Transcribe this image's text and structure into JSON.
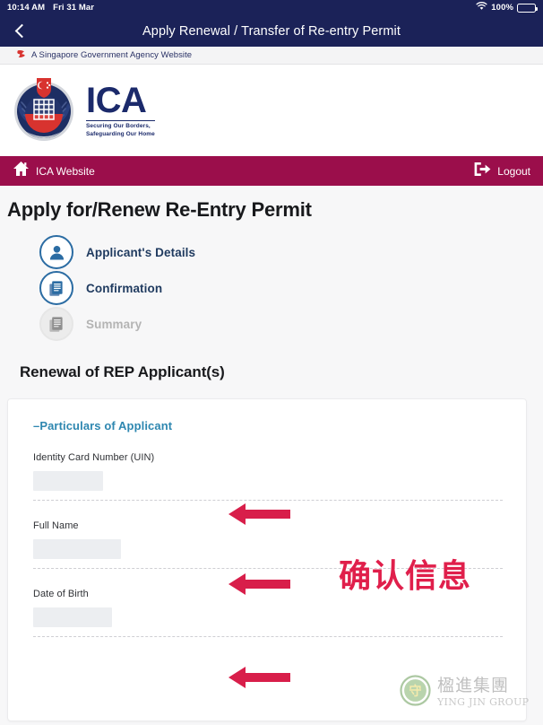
{
  "status_bar": {
    "time": "10:14 AM",
    "date": "Fri 31 Mar",
    "battery_percent": "100%",
    "wifi_icon": "wifi-icon",
    "battery_icon": "battery-full-icon"
  },
  "app_bar": {
    "back_icon": "back-chevron-icon",
    "title": "Apply Renewal / Transfer of Re-entry Permit"
  },
  "gov_banner": {
    "icon": "singapore-flag-icon",
    "text": "A Singapore Government Agency Website"
  },
  "branding": {
    "crest_icon": "ica-crest-icon",
    "acronym": "ICA",
    "tagline_line1": "Securing Our Borders,",
    "tagline_line2": "Safeguarding Our Home"
  },
  "site_bar": {
    "home_icon": "home-icon",
    "home_label": "ICA Website",
    "logout_icon": "logout-icon",
    "logout_label": "Logout",
    "background_color": "#9b0e4b"
  },
  "main": {
    "page_title": "Apply for/Renew Re-Entry Permit",
    "section_title": "Renewal of REP Applicant(s)",
    "steps": [
      {
        "label": "Applicant's Details",
        "icon": "person-icon",
        "state": "active"
      },
      {
        "label": "Confirmation",
        "icon": "document-icon",
        "state": "active"
      },
      {
        "label": "Summary",
        "icon": "document-icon",
        "state": "inactive"
      }
    ],
    "card": {
      "particulars_heading": "–Particulars of Applicant",
      "fields": [
        {
          "label": "Identity Card Number (UIN)",
          "value": "",
          "redacted": true
        },
        {
          "label": "Full Name",
          "value": "",
          "redacted": true
        },
        {
          "label": "Date of Birth",
          "value": "",
          "redacted": true
        }
      ]
    }
  },
  "annotations": {
    "chinese_note": "确认信息",
    "arrow_color": "#d81e4a",
    "arrow_count": 3
  },
  "watermark": {
    "logo_icon": "ying-jin-group-logo-icon",
    "chinese_name": "楹進集團",
    "english_name": "YING JIN GROUP"
  }
}
